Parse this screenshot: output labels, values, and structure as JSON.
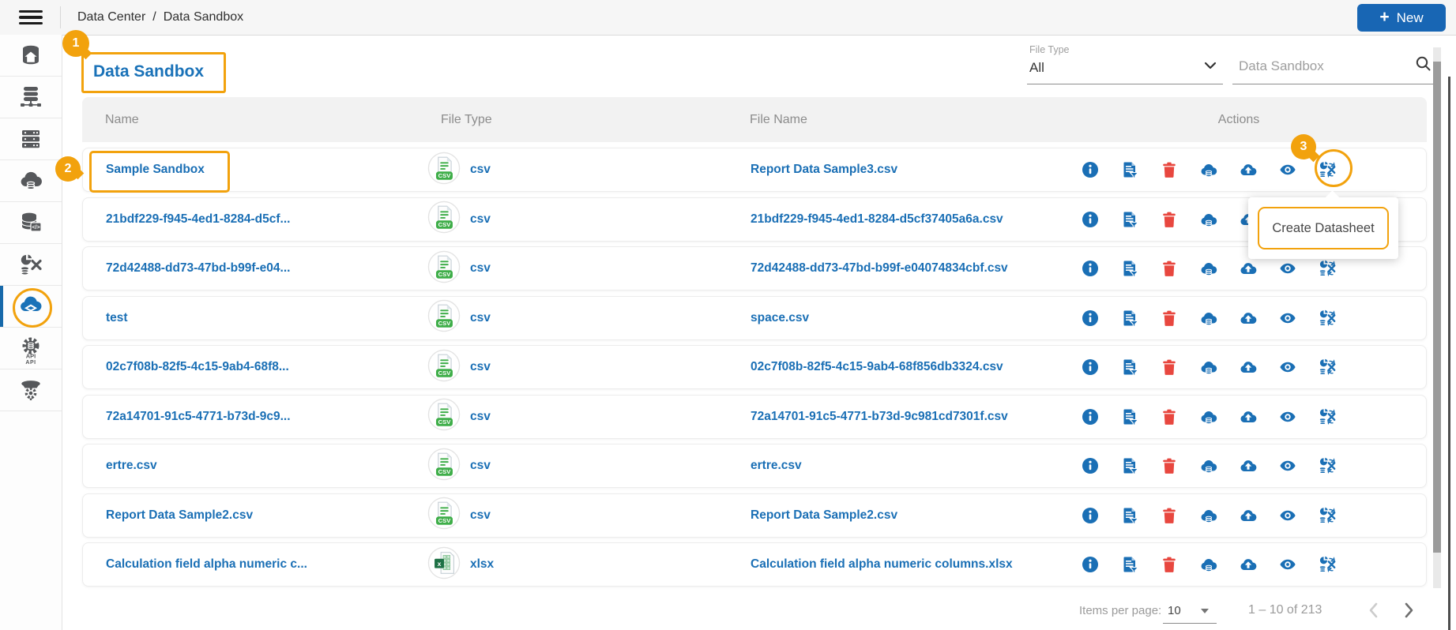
{
  "topbar": {
    "breadcrumb": {
      "items": [
        "Data Center",
        "Data Sandbox"
      ],
      "separator": "/"
    },
    "new_button": {
      "plus": "+",
      "label": "New"
    }
  },
  "sidebar": {
    "items": [
      {
        "icon": "database-home-icon",
        "active": false
      },
      {
        "icon": "database-cluster-icon",
        "active": false
      },
      {
        "icon": "server-rack-icon",
        "active": false
      },
      {
        "icon": "cloud-database-icon",
        "active": false
      },
      {
        "icon": "database-code-icon",
        "active": false
      },
      {
        "icon": "data-transform-icon",
        "active": false
      },
      {
        "icon": "data-sandbox-cloud-icon",
        "active": true
      },
      {
        "icon": "api-gear-icon",
        "active": false,
        "label": "API"
      },
      {
        "icon": "funnel-gear-icon",
        "active": false
      }
    ]
  },
  "page": {
    "title": "Data Sandbox"
  },
  "filters": {
    "file_type_label": "File Type",
    "file_type_value": "All",
    "search_placeholder": "Data Sandbox"
  },
  "table": {
    "columns": [
      "Name",
      "File Type",
      "File Name",
      "Actions"
    ],
    "csv_badge": "CSV",
    "xlsx_badge": "x",
    "action_icons": [
      "info-icon",
      "create-report-icon",
      "delete-icon",
      "cloud-data-icon",
      "upload-icon",
      "preview-icon",
      "create-datasheet-icon"
    ],
    "rows": [
      {
        "name": "Sample Sandbox",
        "type": "csv",
        "file_name": "Report Data Sample3.csv"
      },
      {
        "name": "21bdf229-f945-4ed1-8284-d5cf...",
        "type": "csv",
        "file_name": "21bdf229-f945-4ed1-8284-d5cf37405a6a.csv"
      },
      {
        "name": "72d42488-dd73-47bd-b99f-e04...",
        "type": "csv",
        "file_name": "72d42488-dd73-47bd-b99f-e04074834cbf.csv"
      },
      {
        "name": "test",
        "type": "csv",
        "file_name": "space.csv"
      },
      {
        "name": "02c7f08b-82f5-4c15-9ab4-68f8...",
        "type": "csv",
        "file_name": "02c7f08b-82f5-4c15-9ab4-68f856db3324.csv"
      },
      {
        "name": "72a14701-91c5-4771-b73d-9c9...",
        "type": "csv",
        "file_name": "72a14701-91c5-4771-b73d-9c981cd7301f.csv"
      },
      {
        "name": "ertre.csv",
        "type": "csv",
        "file_name": "ertre.csv"
      },
      {
        "name": "Report Data Sample2.csv",
        "type": "csv",
        "file_name": "Report Data Sample2.csv"
      },
      {
        "name": "Calculation field alpha numeric c...",
        "type": "xlsx",
        "file_name": "Calculation field alpha numeric columns.xlsx"
      }
    ]
  },
  "tooltip": {
    "text": "Create Datasheet"
  },
  "annotations": {
    "step1": "1",
    "step2": "2",
    "step3": "3"
  },
  "pagination": {
    "items_per_page_label": "Items per page:",
    "items_per_page_value": "10",
    "range_label": "1 – 10 of 213"
  },
  "colors": {
    "accent_blue": "#1a6fb5",
    "danger_red": "#e8473f",
    "annotation_orange": "#f2a20d",
    "csv_green": "#3fae49",
    "new_button_blue": "#1866b4"
  }
}
